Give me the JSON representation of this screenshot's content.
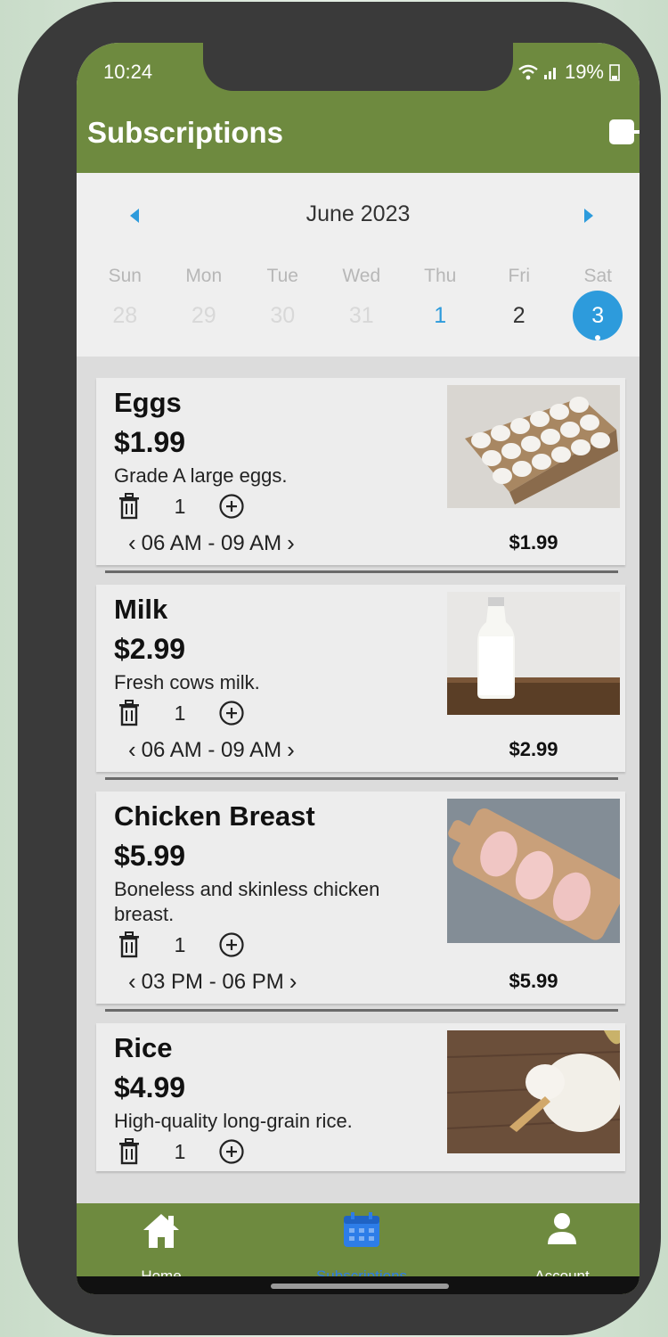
{
  "status_bar": {
    "time": "10:24",
    "battery": "19%"
  },
  "header": {
    "title": "Subscriptions"
  },
  "calendar": {
    "month": "June 2023",
    "weekdays": [
      "Sun",
      "Mon",
      "Tue",
      "Wed",
      "Thu",
      "Fri",
      "Sat"
    ],
    "days": [
      "28",
      "29",
      "30",
      "31",
      "1",
      "2",
      "3"
    ],
    "selected_day": "3"
  },
  "products": [
    {
      "name": "Eggs",
      "price": "$1.99",
      "description": "Grade A large eggs.",
      "quantity": "1",
      "time_slot": "06 AM - 09 AM",
      "total": "$1.99",
      "image": "egg-carton-image"
    },
    {
      "name": "Milk",
      "price": "$2.99",
      "description": "Fresh cows milk.",
      "quantity": "1",
      "time_slot": "06 AM - 09 AM",
      "total": "$2.99",
      "image": "milk-bottle-image"
    },
    {
      "name": "Chicken Breast",
      "price": "$5.99",
      "description": "Boneless and skinless chicken breast.",
      "quantity": "1",
      "time_slot": "03 PM - 06 PM",
      "total": "$5.99",
      "image": "chicken-breast-image"
    },
    {
      "name": "Rice",
      "price": "$4.99",
      "description": "High-quality long-grain rice.",
      "quantity": "1",
      "image": "rice-image"
    }
  ],
  "nav": {
    "home": "Home",
    "subscriptions": "Subscriptions",
    "account": "Account"
  },
  "colors": {
    "header": "#6e8a3f",
    "accent": "#2d9bdc",
    "active_nav": "#2d7de8"
  }
}
